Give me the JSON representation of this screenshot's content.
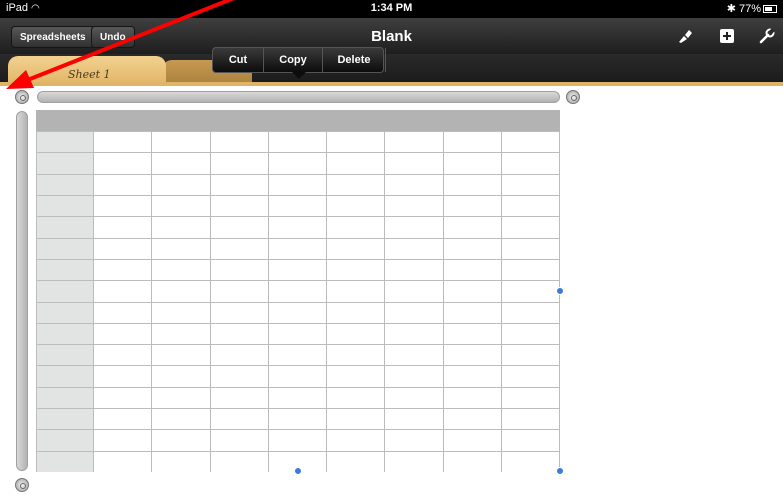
{
  "status_bar": {
    "device": "iPad",
    "time": "1:34 PM",
    "battery": "77%"
  },
  "toolbar": {
    "spreadsheets_label": "Spreadsheets",
    "undo_label": "Undo",
    "title": "Blank",
    "icons": [
      "paintbrush-icon",
      "plus-icon",
      "wrench-icon"
    ]
  },
  "tabs": [
    {
      "label": "Sheet 1",
      "active": true
    },
    {
      "label": "",
      "active": false
    }
  ],
  "context_menu": {
    "items": [
      "Cut",
      "Copy",
      "Delete"
    ]
  },
  "table": {
    "columns": 9,
    "rows": 16,
    "header_color": "#b3b3b3",
    "row_header_color": "#e2e4e4",
    "grid_color": "#bcbcbc"
  },
  "colors": {
    "annotation_arrow": "#ff0000",
    "selection_handle": "#3a7be0",
    "tab_active": "#e0b466"
  }
}
